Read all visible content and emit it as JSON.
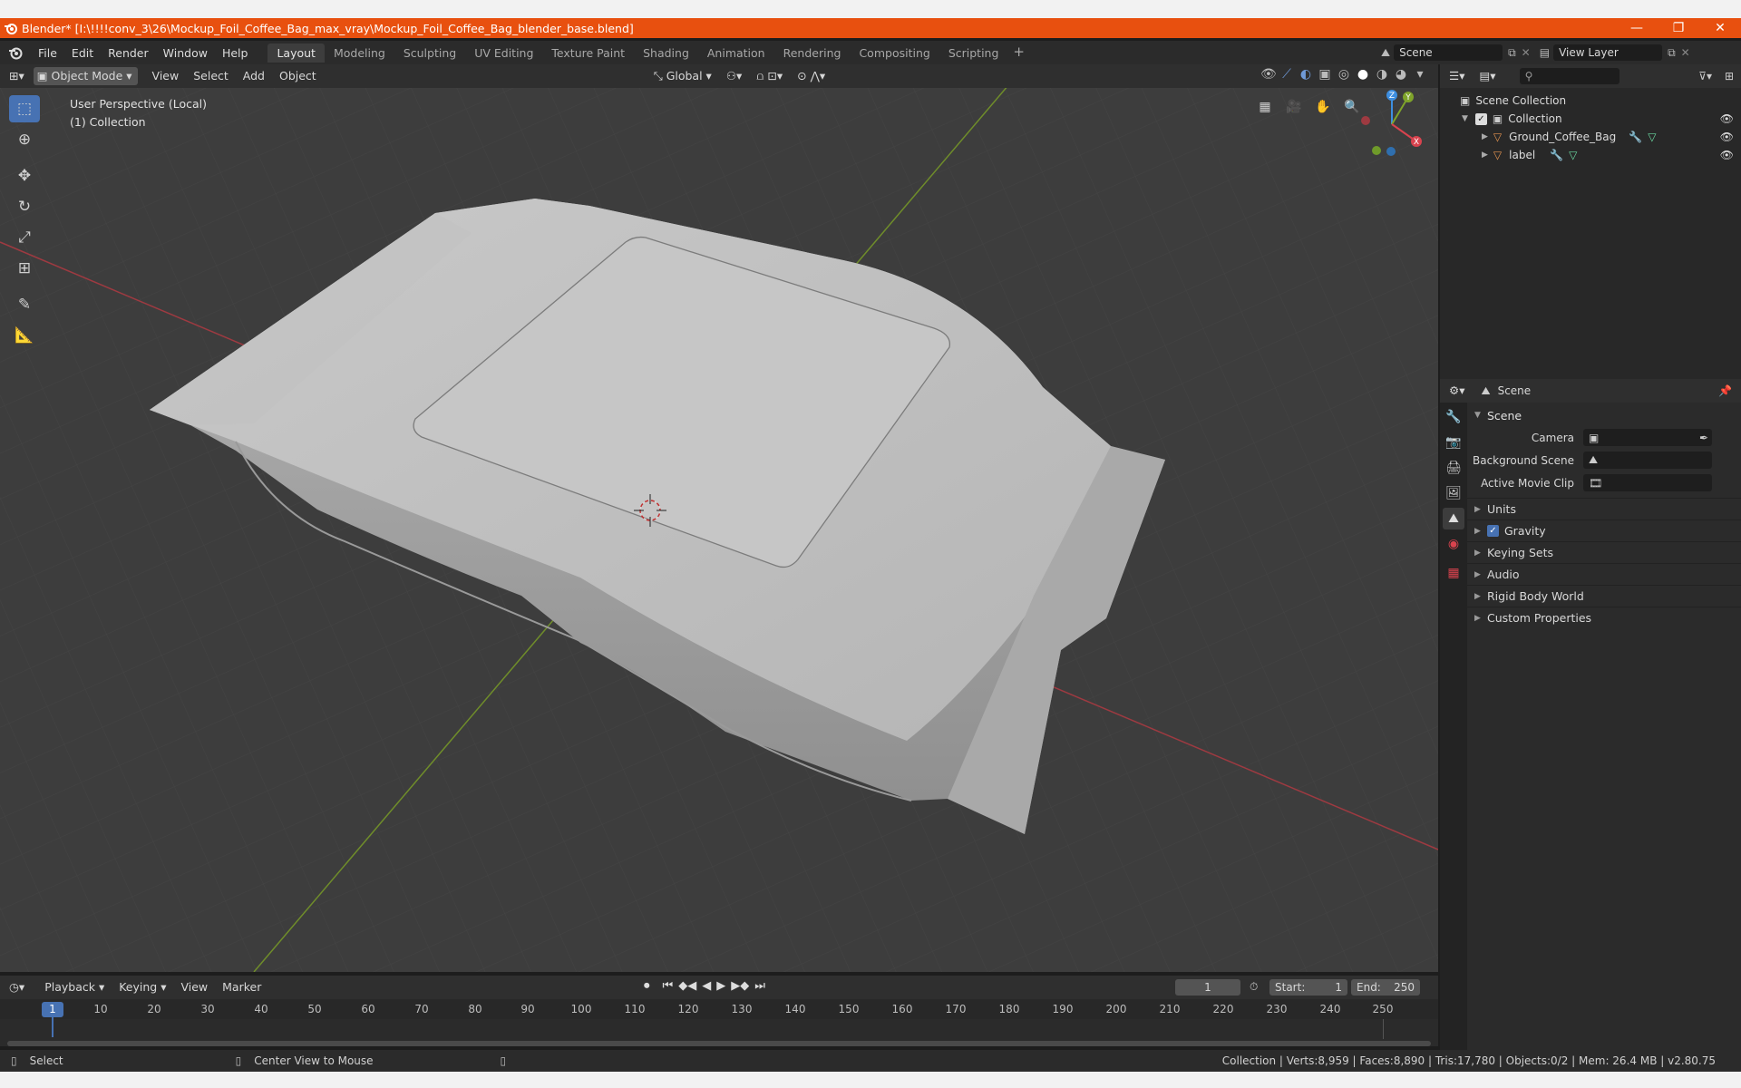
{
  "window": {
    "title": "Blender* [I:\\!!!!conv_3\\26\\Mockup_Foil_Coffee_Bag_max_vray\\Mockup_Foil_Coffee_Bag_blender_base.blend]",
    "minimize": "—",
    "maximize": "❐",
    "close": "✕"
  },
  "menu": {
    "items": [
      "File",
      "Edit",
      "Render",
      "Window",
      "Help"
    ],
    "workspaces": [
      "Layout",
      "Modeling",
      "Sculpting",
      "UV Editing",
      "Texture Paint",
      "Shading",
      "Animation",
      "Rendering",
      "Compositing",
      "Scripting"
    ],
    "active_workspace": "Layout",
    "scene_name": "Scene",
    "view_layer": "View Layer"
  },
  "viewport_header": {
    "mode": "Object Mode",
    "menus": [
      "View",
      "Select",
      "Add",
      "Object"
    ],
    "transform_orientation": "Global"
  },
  "viewport": {
    "perspective_label": "User Perspective (Local)",
    "collection_label": "(1) Collection",
    "gizmo_axes": [
      "Z",
      "Y",
      "X"
    ],
    "accent": "#4772b3",
    "x_axis_color": "#d9434e",
    "y_axis_color": "#7fa42a",
    "z_axis_color": "#3d8ee0"
  },
  "timeline": {
    "menus": [
      "Playback",
      "Keying",
      "View",
      "Marker"
    ],
    "current_frame": "1",
    "start_label": "Start:",
    "start": "1",
    "end_label": "End:",
    "end": "250",
    "ticks": [
      "1",
      "10",
      "20",
      "30",
      "40",
      "50",
      "60",
      "70",
      "80",
      "90",
      "100",
      "110",
      "120",
      "130",
      "140",
      "150",
      "160",
      "170",
      "180",
      "190",
      "200",
      "210",
      "220",
      "230",
      "240",
      "250"
    ]
  },
  "statusbar": {
    "left_action": "Select",
    "middle_action": "Center View to Mouse",
    "stats": "Collection | Verts:8,959 | Faces:8,890 | Tris:17,780 | Objects:0/2 | Mem: 26.4 MB | v2.80.75"
  },
  "outliner": {
    "root": "Scene Collection",
    "collection": "Collection",
    "objects": [
      "Ground_Coffee_Bag",
      "label"
    ]
  },
  "properties": {
    "context": "Scene",
    "panel_title": "Scene",
    "fields": [
      {
        "label": "Camera"
      },
      {
        "label": "Background Scene"
      },
      {
        "label": "Active Movie Clip"
      }
    ],
    "subpanels": [
      "Units",
      "Gravity",
      "Keying Sets",
      "Audio",
      "Rigid Body World",
      "Custom Properties"
    ],
    "gravity_checked": true
  }
}
